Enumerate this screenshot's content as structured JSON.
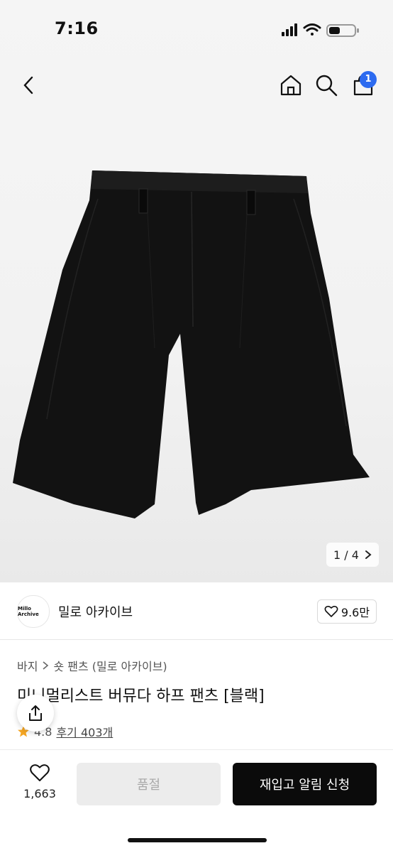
{
  "status_bar": {
    "time": "7:16"
  },
  "nav": {
    "cart_count": "1"
  },
  "gallery": {
    "current": "1",
    "total": "4",
    "separator": "/",
    "counter": "1 / 4"
  },
  "brand": {
    "logo_text": "Millo Archive",
    "name": "밀로 아카이브",
    "likes": "9.6만"
  },
  "breadcrumb": {
    "level1": "바지",
    "level2": "숏 팬츠 (밀로 아카이브)"
  },
  "product": {
    "title": "미니멀리스트 버뮤다 하프 팬츠 [블랙]",
    "rating": "4.8",
    "reviews": "후기 403개"
  },
  "bottom": {
    "wish_count": "1,663",
    "soldout_label": "품절",
    "restock_label": "재입고 알림 신청"
  },
  "colors": {
    "accent": "#2d6bf0",
    "primary_button": "#0b0b0b",
    "disabled_button": "#ececec",
    "star": "#f5a623"
  }
}
